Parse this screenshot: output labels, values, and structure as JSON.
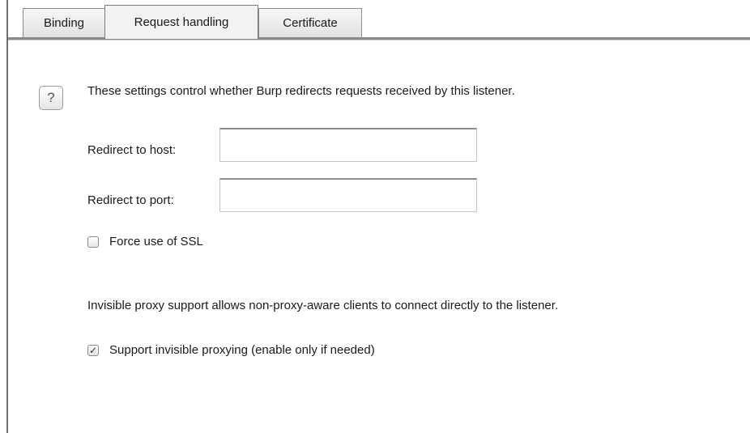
{
  "tabs": [
    {
      "label": "Binding",
      "active": false
    },
    {
      "label": "Request handling",
      "active": true
    },
    {
      "label": "Certificate",
      "active": false
    }
  ],
  "help": {
    "icon": "help-icon",
    "glyph": "?"
  },
  "description": "These settings control whether Burp redirects requests received by this listener.",
  "redirect_host": {
    "label": "Redirect to host:",
    "value": "",
    "placeholder": ""
  },
  "redirect_port": {
    "label": "Redirect to port:",
    "value": "",
    "placeholder": ""
  },
  "force_ssl": {
    "label": "Force use of SSL",
    "checked": false,
    "mark": ""
  },
  "invisible_info": "Invisible proxy support allows non-proxy-aware clients to connect directly to the listener.",
  "invisible_proxy": {
    "label": "Support invisible proxying (enable only if needed)",
    "checked": true,
    "mark": "✓"
  }
}
